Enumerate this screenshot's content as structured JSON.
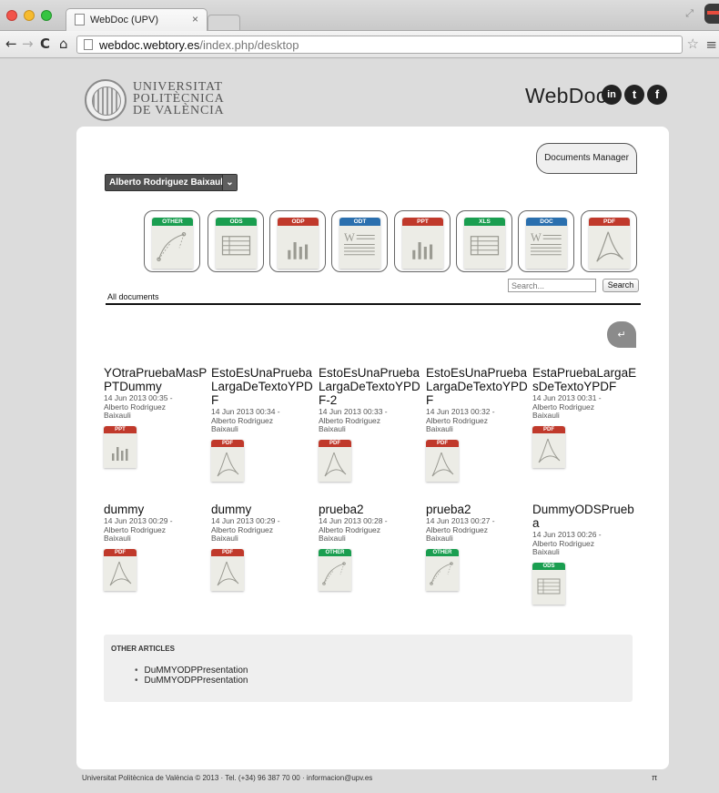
{
  "browser": {
    "tab_title": "WebDoc (UPV)",
    "tab_close": "×",
    "url_prefix": "",
    "url_host": "webdoc.webtory.es",
    "url_path": "/index.php/desktop"
  },
  "header": {
    "university_lines": [
      "UNIVERSITAT",
      "POLITÈCNICA",
      "DE VALÈNCIA"
    ],
    "brand": "WebDoc",
    "social": {
      "linkedin": "in",
      "twitter": "t",
      "facebook": "f"
    }
  },
  "toolbar": {
    "documents_manager": "Documents Manager",
    "user": "Alberto Rodriguez Baixauli",
    "all_documents": "All documents",
    "search_placeholder": "Search...",
    "search_button": "Search",
    "back_glyph": "↵"
  },
  "colors": {
    "OTHER": "#1a9e50",
    "ODS": "#1a9e50",
    "XLS": "#1a9e50",
    "ODP": "#c0392b",
    "PPT": "#c0392b",
    "PDF": "#c0392b",
    "ODT": "#2a6fae",
    "DOC": "#2a6fae"
  },
  "filters": [
    "OTHER",
    "ODS",
    "ODP",
    "ODT",
    "PPT",
    "XLS",
    "DOC",
    "PDF"
  ],
  "documents": [
    {
      "title": "YOtraPruebaMasPPTDummy",
      "meta": "14 Jun 2013 00:35 - Alberto Rodriguez Baixauli",
      "type": "PPT"
    },
    {
      "title": "EstoEsUnaPruebaLargaDeTextoYPDF",
      "meta": "14 Jun 2013 00:34 - Alberto Rodriguez Baixauli",
      "type": "PDF"
    },
    {
      "title": "EstoEsUnaPruebaLargaDeTextoYPDF-2",
      "meta": "14 Jun 2013 00:33 - Alberto Rodriguez Baixauli",
      "type": "PDF"
    },
    {
      "title": "EstoEsUnaPruebaLargaDeTextoYPDF",
      "meta": "14 Jun 2013 00:32 - Alberto Rodriguez Baixauli",
      "type": "PDF"
    },
    {
      "title": "EstaPruebaLargaEsDeTextoYPDF",
      "meta": "14 Jun 2013 00:31 - Alberto Rodriguez Baixauli",
      "type": "PDF"
    },
    {
      "title": "dummy",
      "meta": "14 Jun 2013 00:29 - Alberto Rodriguez Baixauli",
      "type": "PDF"
    },
    {
      "title": "dummy",
      "meta": "14 Jun 2013 00:29 - Alberto Rodriguez Baixauli",
      "type": "PDF"
    },
    {
      "title": "prueba2",
      "meta": "14 Jun 2013 00:28 - Alberto Rodriguez Baixauli",
      "type": "OTHER"
    },
    {
      "title": "prueba2",
      "meta": "14 Jun 2013 00:27 - Alberto Rodriguez Baixauli",
      "type": "OTHER"
    },
    {
      "title": "DummyODSPrueba",
      "meta": "14 Jun 2013 00:26 - Alberto Rodriguez Baixauli",
      "type": "ODS"
    }
  ],
  "other_articles": {
    "title": "OTHER ARTICLES",
    "items": [
      "DuMMYODPPresentation",
      "DuMMYODPPresentation"
    ]
  },
  "footer": {
    "text": "Universitat Politècnica de València © 2013 · Tel. (+34) 96 387 70 00 · informacion@upv.es",
    "pi": "π"
  }
}
